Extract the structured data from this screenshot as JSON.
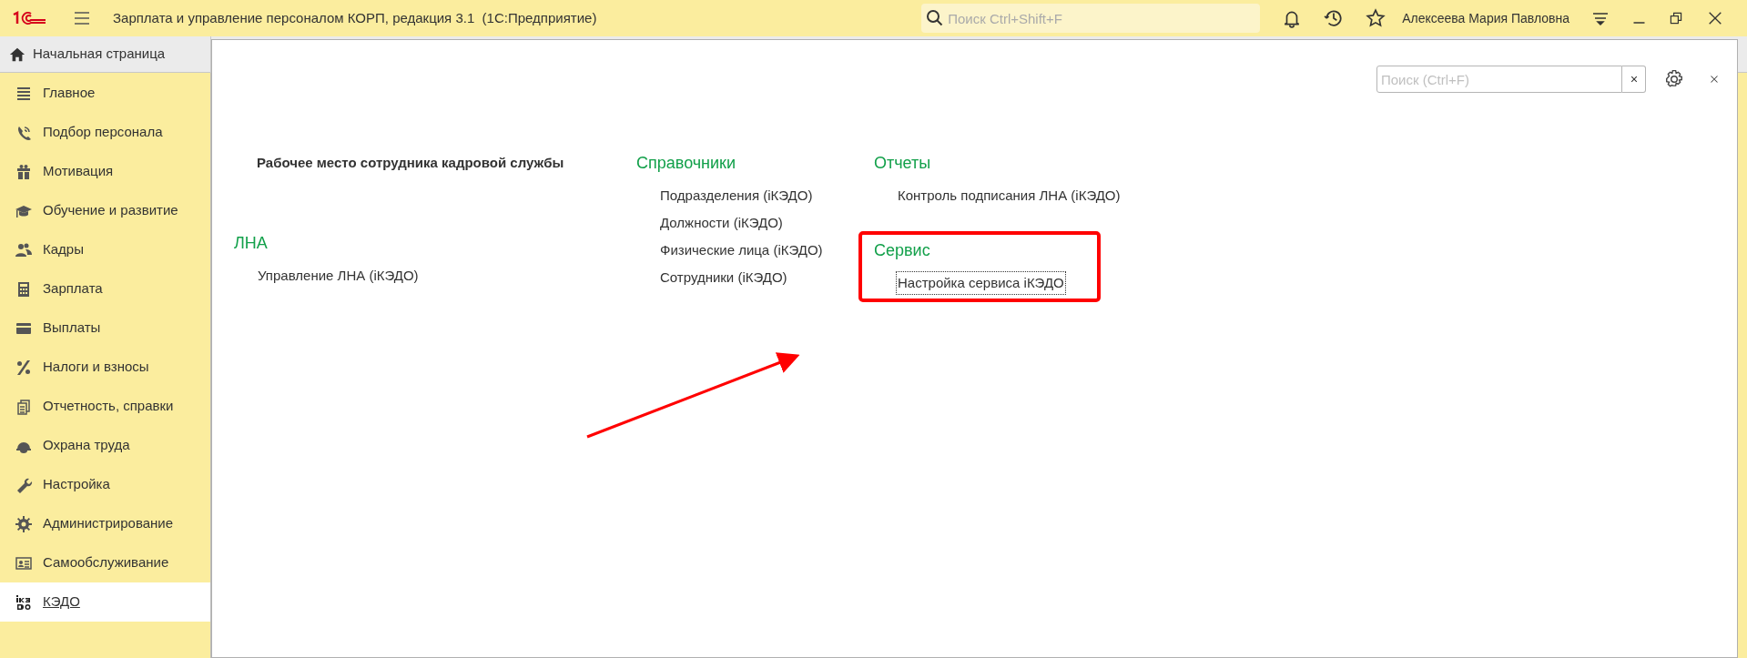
{
  "window": {
    "title": "Зарплата и управление персоналом КОРП, редакция 3.1  (1С:Предприятие)",
    "search": {
      "placeholder": "Поиск Ctrl+Shift+F"
    },
    "user": "Алексеева Мария Павловна"
  },
  "home_tab": {
    "label": "Начальная страница"
  },
  "sidebar": {
    "items": [
      {
        "label": "Главное",
        "selected": false
      },
      {
        "label": "Подбор персонала",
        "selected": false
      },
      {
        "label": "Мотивация",
        "selected": false
      },
      {
        "label": "Обучение и развитие",
        "selected": false
      },
      {
        "label": "Кадры",
        "selected": false
      },
      {
        "label": "Зарплата",
        "selected": false
      },
      {
        "label": "Выплаты",
        "selected": false
      },
      {
        "label": "Налоги и взносы",
        "selected": false
      },
      {
        "label": "Отчетность, справки",
        "selected": false
      },
      {
        "label": "Охрана труда",
        "selected": false
      },
      {
        "label": "Настройка",
        "selected": false
      },
      {
        "label": "Администрирование",
        "selected": false
      },
      {
        "label": "Самообслуживание",
        "selected": false
      },
      {
        "label": "КЭДО",
        "selected": true
      }
    ]
  },
  "panel": {
    "search": {
      "placeholder": "Поиск (Ctrl+F)"
    },
    "columns": [
      {
        "groups": [
          {
            "title": "Рабочее место сотрудника кадровой службы",
            "kind": "bold"
          },
          {
            "title": "ЛНА",
            "kind": "section",
            "links": [
              {
                "label": "Управление ЛНА (iКЭДО)",
                "focused": false
              }
            ]
          }
        ]
      },
      {
        "groups": [
          {
            "title": "Справочники",
            "kind": "section",
            "links": [
              {
                "label": "Подразделения (iКЭДО)",
                "focused": false
              },
              {
                "label": "Должности (iКЭДО)",
                "focused": false
              },
              {
                "label": "Физические лица (iКЭДО)",
                "focused": false
              },
              {
                "label": "Сотрудники (iКЭДО)",
                "focused": false
              }
            ]
          }
        ]
      },
      {
        "groups": [
          {
            "title": "Отчеты",
            "kind": "section",
            "links": [
              {
                "label": "Контроль подписания ЛНА (iКЭДО)",
                "focused": false
              }
            ]
          },
          {
            "title": "Сервис",
            "kind": "section",
            "links": [
              {
                "label": "Настройка сервиса iКЭДО",
                "focused": true
              }
            ]
          }
        ]
      }
    ]
  }
}
